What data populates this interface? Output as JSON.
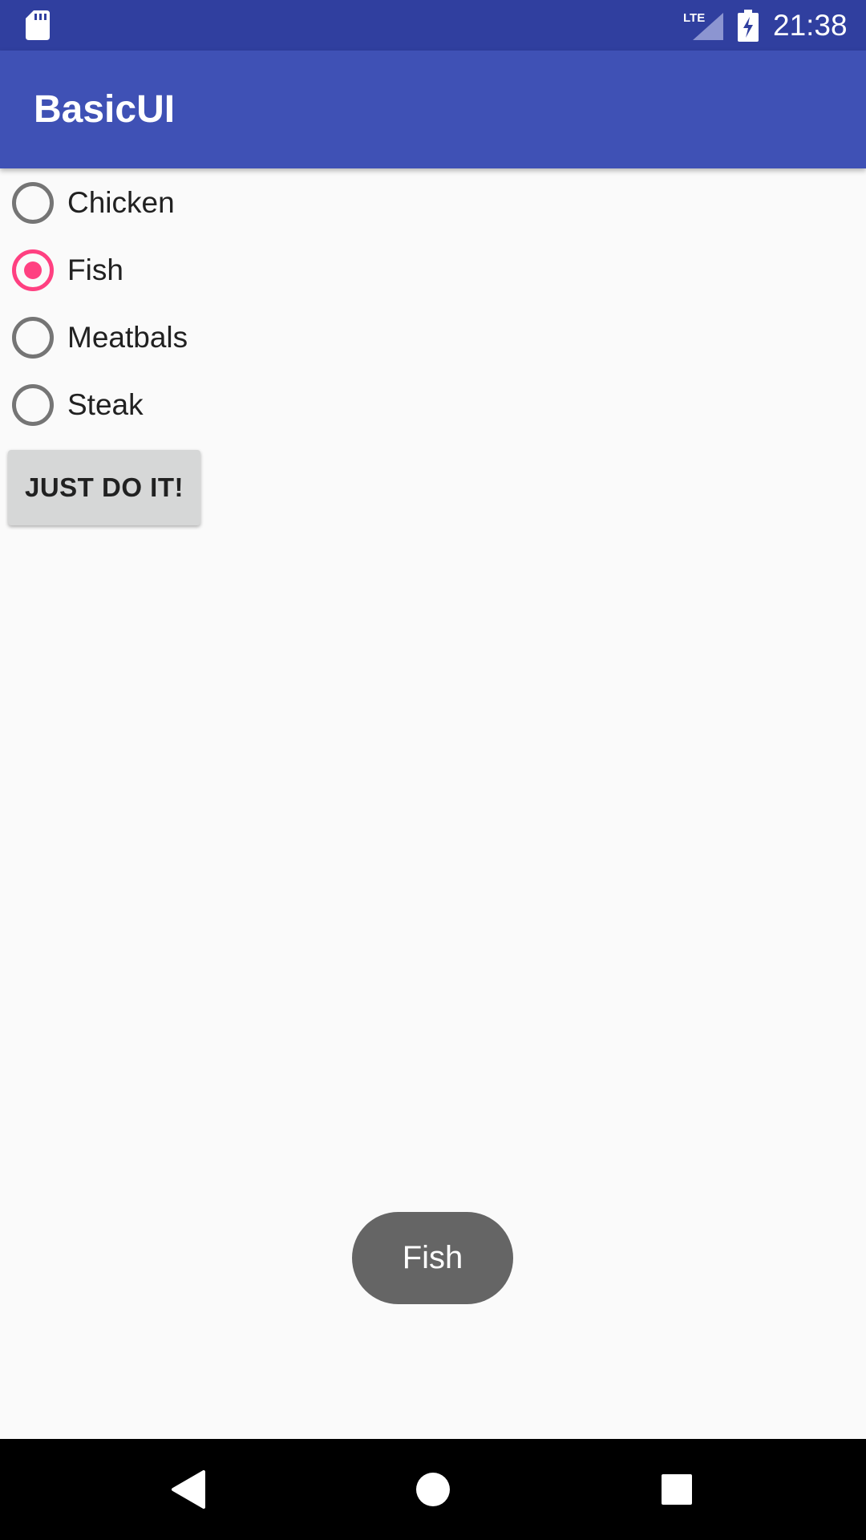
{
  "status_bar": {
    "time": "21:38",
    "network_label": "LTE",
    "icons": [
      "sd-card-icon",
      "lte-signal-icon",
      "battery-charging-icon"
    ]
  },
  "app_bar": {
    "title": "BasicUI"
  },
  "radio_group": {
    "options": [
      {
        "label": "Chicken",
        "checked": false
      },
      {
        "label": "Fish",
        "checked": true
      },
      {
        "label": "Meatbals",
        "checked": false
      },
      {
        "label": "Steak",
        "checked": false
      }
    ],
    "accent_color": "#FF4081"
  },
  "action_button": {
    "label": "JUST DO IT!"
  },
  "toast": {
    "message": "Fish"
  },
  "nav_bar": {
    "icons": [
      "back-icon",
      "home-icon",
      "recent-apps-icon"
    ]
  },
  "colors": {
    "status_bar": "#303F9F",
    "app_bar": "#3F51B5",
    "background": "#FAFAFA",
    "accent": "#FF4081"
  }
}
